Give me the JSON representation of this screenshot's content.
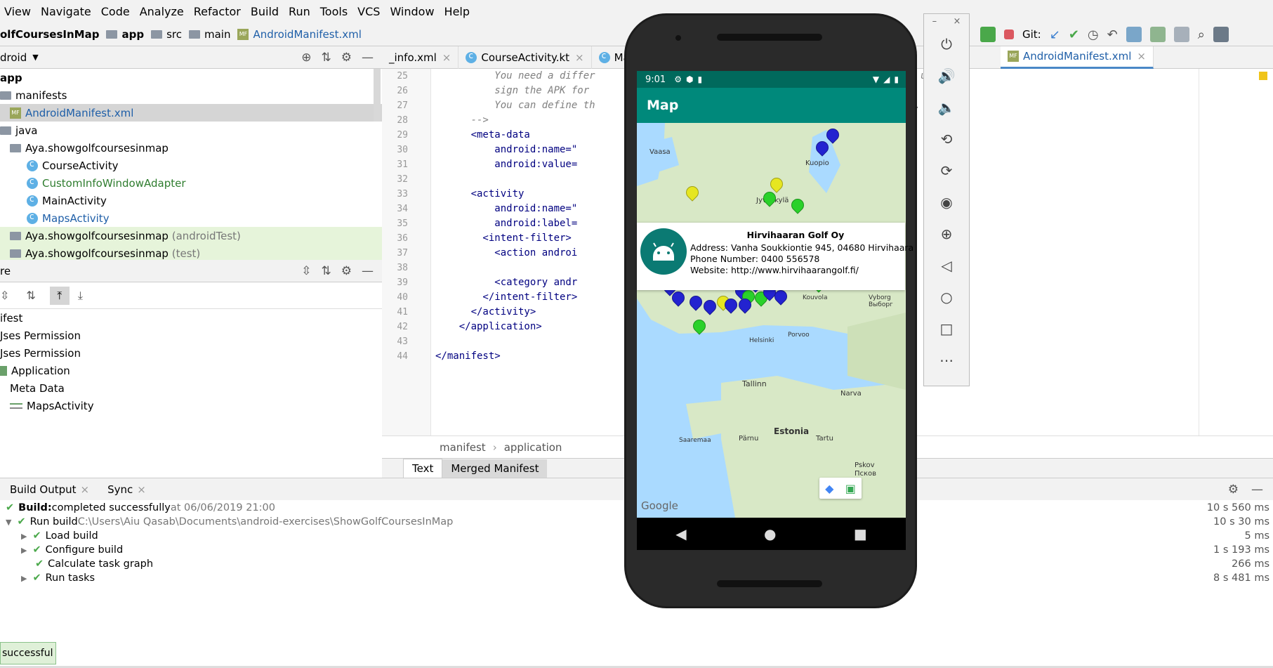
{
  "menu": [
    "View",
    "Navigate",
    "Code",
    "Analyze",
    "Refactor",
    "Build",
    "Run",
    "Tools",
    "VCS",
    "Window",
    "Help"
  ],
  "breadcrumb": [
    "olfCoursesInMap",
    "app",
    "src",
    "main",
    "AndroidManifest.xml"
  ],
  "project_panel": {
    "mode": "droid",
    "tree": [
      {
        "label": "app",
        "indent": 0,
        "kind": "bold"
      },
      {
        "label": "manifests",
        "indent": 1,
        "kind": "folder"
      },
      {
        "label": "AndroidManifest.xml",
        "indent": 2,
        "kind": "manifest"
      },
      {
        "label": "java",
        "indent": 1,
        "kind": "folder"
      },
      {
        "label": "Aya.showgolfcoursesinmap",
        "indent": 1,
        "kind": "pkg"
      },
      {
        "label": "CourseActivity",
        "indent": 2,
        "kind": "class"
      },
      {
        "label": "CustomInfoWindowAdapter",
        "indent": 2,
        "kind": "class-green"
      },
      {
        "label": "MainActivity",
        "indent": 2,
        "kind": "class"
      },
      {
        "label": "MapsActivity",
        "indent": 2,
        "kind": "class-blue"
      },
      {
        "label": "Aya.showgolfcoursesinmap",
        "suffix": "(androidTest)",
        "indent": 1,
        "kind": "pkg-hl"
      },
      {
        "label": "Aya.showgolfcoursesinmap",
        "suffix": "(test)",
        "indent": 1,
        "kind": "pkg-hl"
      }
    ]
  },
  "structure_panel": {
    "title": "re",
    "items": [
      "ifest",
      "Jses Permission",
      "Jses Permission",
      "Application",
      "Meta Data",
      "MapsActivity"
    ]
  },
  "editor": {
    "tabs": [
      "_info.xml",
      "CourseActivity.kt",
      "MainAct",
      "AndroidManifest.xml"
    ],
    "active_tab": "AndroidManifest.xml",
    "line_numbers": [
      "25",
      "26",
      "27",
      "28",
      "29",
      "30",
      "31",
      "32",
      "33",
      "34",
      "35",
      "36",
      "37",
      "38",
      "39",
      "40",
      "41",
      "42",
      "43",
      "44"
    ],
    "lines": [
      "          You need a differ                                     lease key that is used to",
      "          sign the APK for",
      "          You can define th                                    c and src/release/.",
      "      -->",
      "      <meta-data",
      "          android:name=\"",
      "          android:value=",
      "",
      "      <activity",
      "          android:name=\"",
      "          android:label=",
      "        <intent-filter>",
      "          <action androi",
      "",
      "          <category andr",
      "        </intent-filter>",
      "      </activity>",
      "    </application>",
      "",
      "</manifest>"
    ],
    "path": [
      "manifest",
      "application"
    ],
    "bottom_tabs": [
      "Text",
      "Merged Manifest"
    ]
  },
  "build": {
    "tabs": [
      "Build Output",
      "Sync"
    ],
    "rows": [
      {
        "text": "Build:",
        "rest": " completed successfully",
        "extra": " at 06/06/2019 21:00",
        "time": "10 s 560 ms"
      },
      {
        "text": "Run build",
        "extra": " C:\\Users\\Aiu Qasab\\Documents\\android-exercises\\ShowGolfCoursesInMap",
        "time": "10 s 30 ms"
      },
      {
        "text": "Load build",
        "time": "5 ms"
      },
      {
        "text": "Configure build",
        "time": "1 s 193 ms"
      },
      {
        "text": "Calculate task graph",
        "time": "266 ms"
      },
      {
        "text": "Run tasks",
        "time": "8 s 481 ms"
      }
    ],
    "toast": "successful"
  },
  "toolbar_right": {
    "git_label": "Git:"
  },
  "phone": {
    "time": "9:01",
    "app_title": "Map",
    "info": {
      "name": "Hirvihaaran Golf Oy",
      "address": "Address: Vanha Soukkiontie 945, 04680 Hirvihaara",
      "phone": "Phone Number: 0400 556578",
      "website": "Website: http://www.hirvihaarangolf.fi/"
    },
    "map_labels": [
      "Vaasa",
      "Kuopio",
      "Jyväskylä",
      "Tallinn",
      "Estonia",
      "Narva",
      "Tartu",
      "Pärnu",
      "Saaremaa",
      "Pskov",
      "Псков",
      "Vyborg",
      "Выборг",
      "Porvoo",
      "Kouvola",
      "Helsinki"
    ],
    "google": "Google"
  },
  "colors": {
    "accent": "#00897b",
    "status": "#00695c",
    "pin_blue": "#2323d0",
    "pin_green": "#2ad12a",
    "pin_yellow": "#e6e621"
  }
}
